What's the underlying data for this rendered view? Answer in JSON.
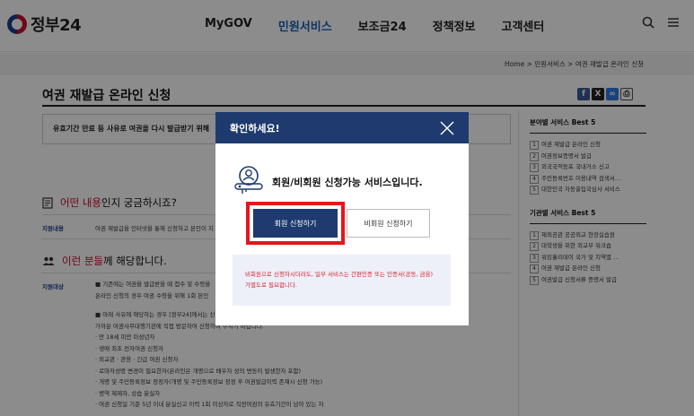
{
  "header": {
    "logo_text": "정부24",
    "nav": [
      "MyGOV",
      "민원서비스",
      "보조금24",
      "정책정보",
      "고객센터"
    ],
    "active_nav": "민원서비스"
  },
  "breadcrumb": {
    "home": "Home",
    "sep": ">",
    "level1": "민원서비스",
    "level2": "여권 재발급 온라인 신청"
  },
  "page": {
    "title": "여권 재발급 온라인 신청",
    "share_icons": [
      "facebook-icon",
      "x-icon",
      "link-icon",
      "print-icon"
    ],
    "intro_text": "유효기간 만료 등 사유로 여권을 다시 발급받기 위해"
  },
  "section1": {
    "heading_highlight": "어떤 내용",
    "heading_rest": "인지 궁금하시죠?",
    "label": "지원내용",
    "text": "여권 재발급을 인터넷을 통해 신청하고 본인이 지"
  },
  "section2": {
    "heading_highlight": "이런 분들",
    "heading_rest": "께 해당합니다.",
    "label": "지원대상",
    "lines": [
      "■ 기존에는 여권을 발급받을 때 접수 및 수령을",
      "온라인 신청의 경우 여권 수령을 위해 1회 본인",
      "",
      "■ 아래 사유에 해당하는 경우 [정부24]에서는 신",
      "가까운 여권사무대행기관에 직접 방문하여 신청하여 주시기 바랍니다.",
      "· 만 18세 미만 미성년자",
      "· 생애 최초 전자여권 신청자",
      "· 외교관 · 관용 · 긴급 여권 신청자",
      "· 로마자성명 변경이 필요한자(온라인은 개명으로 배우자 성의 변동이 발생한자 포함)",
      "· 개명 및 주민등록정보 정정자(개명 및 주민등록정보 정정 후 여권발급이력 존재시 신청 가능)",
      "· 병역 제제자, 상습 분실자",
      "· 여권 신청일 기준 5년 이내 분실신고 이력 1회 이상자로 직전여권의 유효기간이 남아 있는 자"
    ]
  },
  "sidebar": {
    "section1_title": "분야별 서비스 Best 5",
    "section1_items": [
      "여권 재발급 온라인 신청",
      "여권정보증명서 발급",
      "외국국적동포 국내거소 신고",
      "주민등록번호 이용내역 검색서…",
      "대한민국 자동출입국심사 서비스"
    ],
    "section2_title": "기관별 서비스 Best 5",
    "section2_items": [
      "재외공관 공공외교 현장실습원",
      "대학생을 위한 외교부 워크숍",
      "워킹홀리데이 국가 및 지역별 …",
      "여권 재발급 온라인 신청",
      "여권발급 신청서류 증명서 발급"
    ]
  },
  "modal": {
    "title": "확인하세요!",
    "message": "회원/비회원 신청가능 서비스입니다.",
    "member_button": "회원 신청하기",
    "guest_button": "비회원 신청하기",
    "notice": "비회원으로 신청하시더라도, 일부 서비스는 간편인증 또는 인증서(공동, 금융) 가별도로 필요합니다.",
    "colors": {
      "header": "#1e3a6e",
      "highlight": "#e5161e",
      "notice_text": "#d42230"
    }
  }
}
